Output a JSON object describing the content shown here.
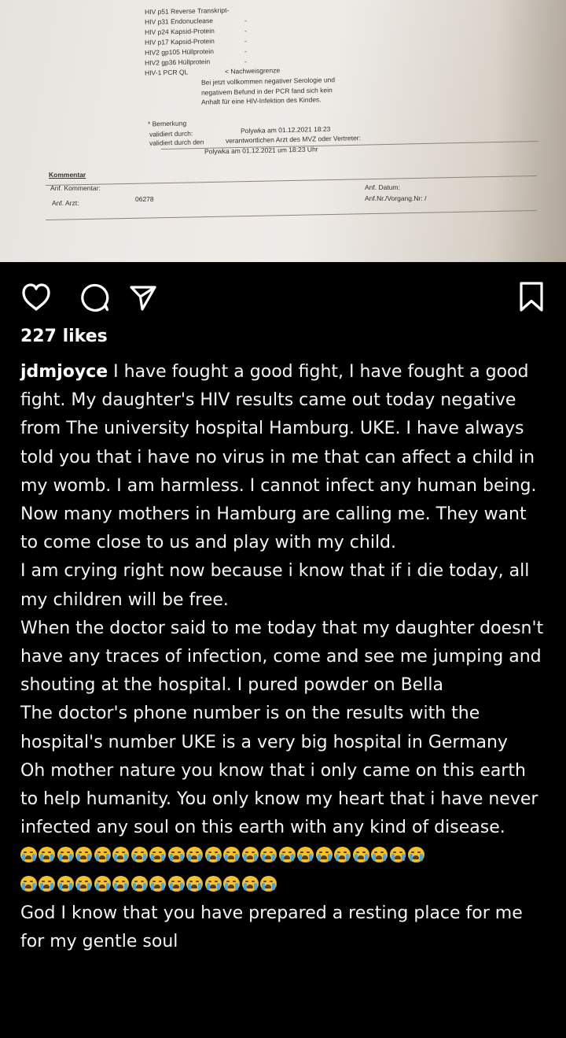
{
  "document_photo": {
    "lines": [
      "HIV p51 Reverse Transkript-",
      "HIV p31 Endonuclease",
      "HIV p24 Kapsid-Protein",
      "HIV p17 Kapsid-Protein",
      "HIV2 gp105 Hüllprotein",
      "HIV2 gp36 Hüllprotein",
      "HIV-1 PCR QL",
      "< Nachweisgrenze",
      "Bei jetzt vollkommen negativer Serologie und",
      "negativem Befund in der PCR fand sich kein",
      "Anhalt für eine HIV-Infektion des Kindes.",
      "* Bemerkung",
      "validiert durch:",
      "Polywka am 01.12.2021 18:23",
      "validiert durch den",
      "verantwortlichen Arzt des MVZ oder Vertreter:",
      "Polywka   am  01.12.2021  um  18:23  Uhr",
      "Kommentar",
      "Anf. Kommentar:",
      "Anf. Arzt:",
      "06278",
      "Anf. Datum:",
      "Anf.Nr./Vorgang.Nr:   /"
    ],
    "dashes": [
      "-",
      "-",
      "-",
      "-",
      "-"
    ]
  },
  "actions": {
    "like_icon": "heart-icon",
    "comment_icon": "comment-icon",
    "share_icon": "share-icon",
    "save_icon": "bookmark-icon"
  },
  "post": {
    "likes": "227 likes",
    "username": "jdmjoyce",
    "caption_first": "I have fought a good fight, I have fought a good fight. My daughter's HIV results came out today negative from The university hospital Hamburg. UKE. I have always told you that i have no virus in me that can affect a child in my womb. I am harmless. I cannot infect any human being.",
    "caption_paragraphs": [
      "Now many mothers in Hamburg are calling me. They want to come close to us and play with my child.",
      "I am crying right now because i know that if i die today, all my children will be free.",
      "When the doctor said to me today that my daughter doesn't have any traces of infection, come and see me jumping and shouting at the hospital. I pured powder on Bella",
      "The doctor's phone number is on the results with the hospital's number UKE is a very big hospital in Germany",
      "Oh mother nature you know that i only came on this earth to help humanity. You only know my heart that i have never infected any soul on this earth with any kind of disease.",
      "God I know that you have prepared a resting place for me for my gentle soul"
    ],
    "emoji_name": "loudly-crying-face-emoji",
    "emoji_rows": [
      22,
      14
    ]
  },
  "colors": {
    "background": "#000000",
    "text": "#ffffff",
    "paper": "#ece9e5"
  }
}
